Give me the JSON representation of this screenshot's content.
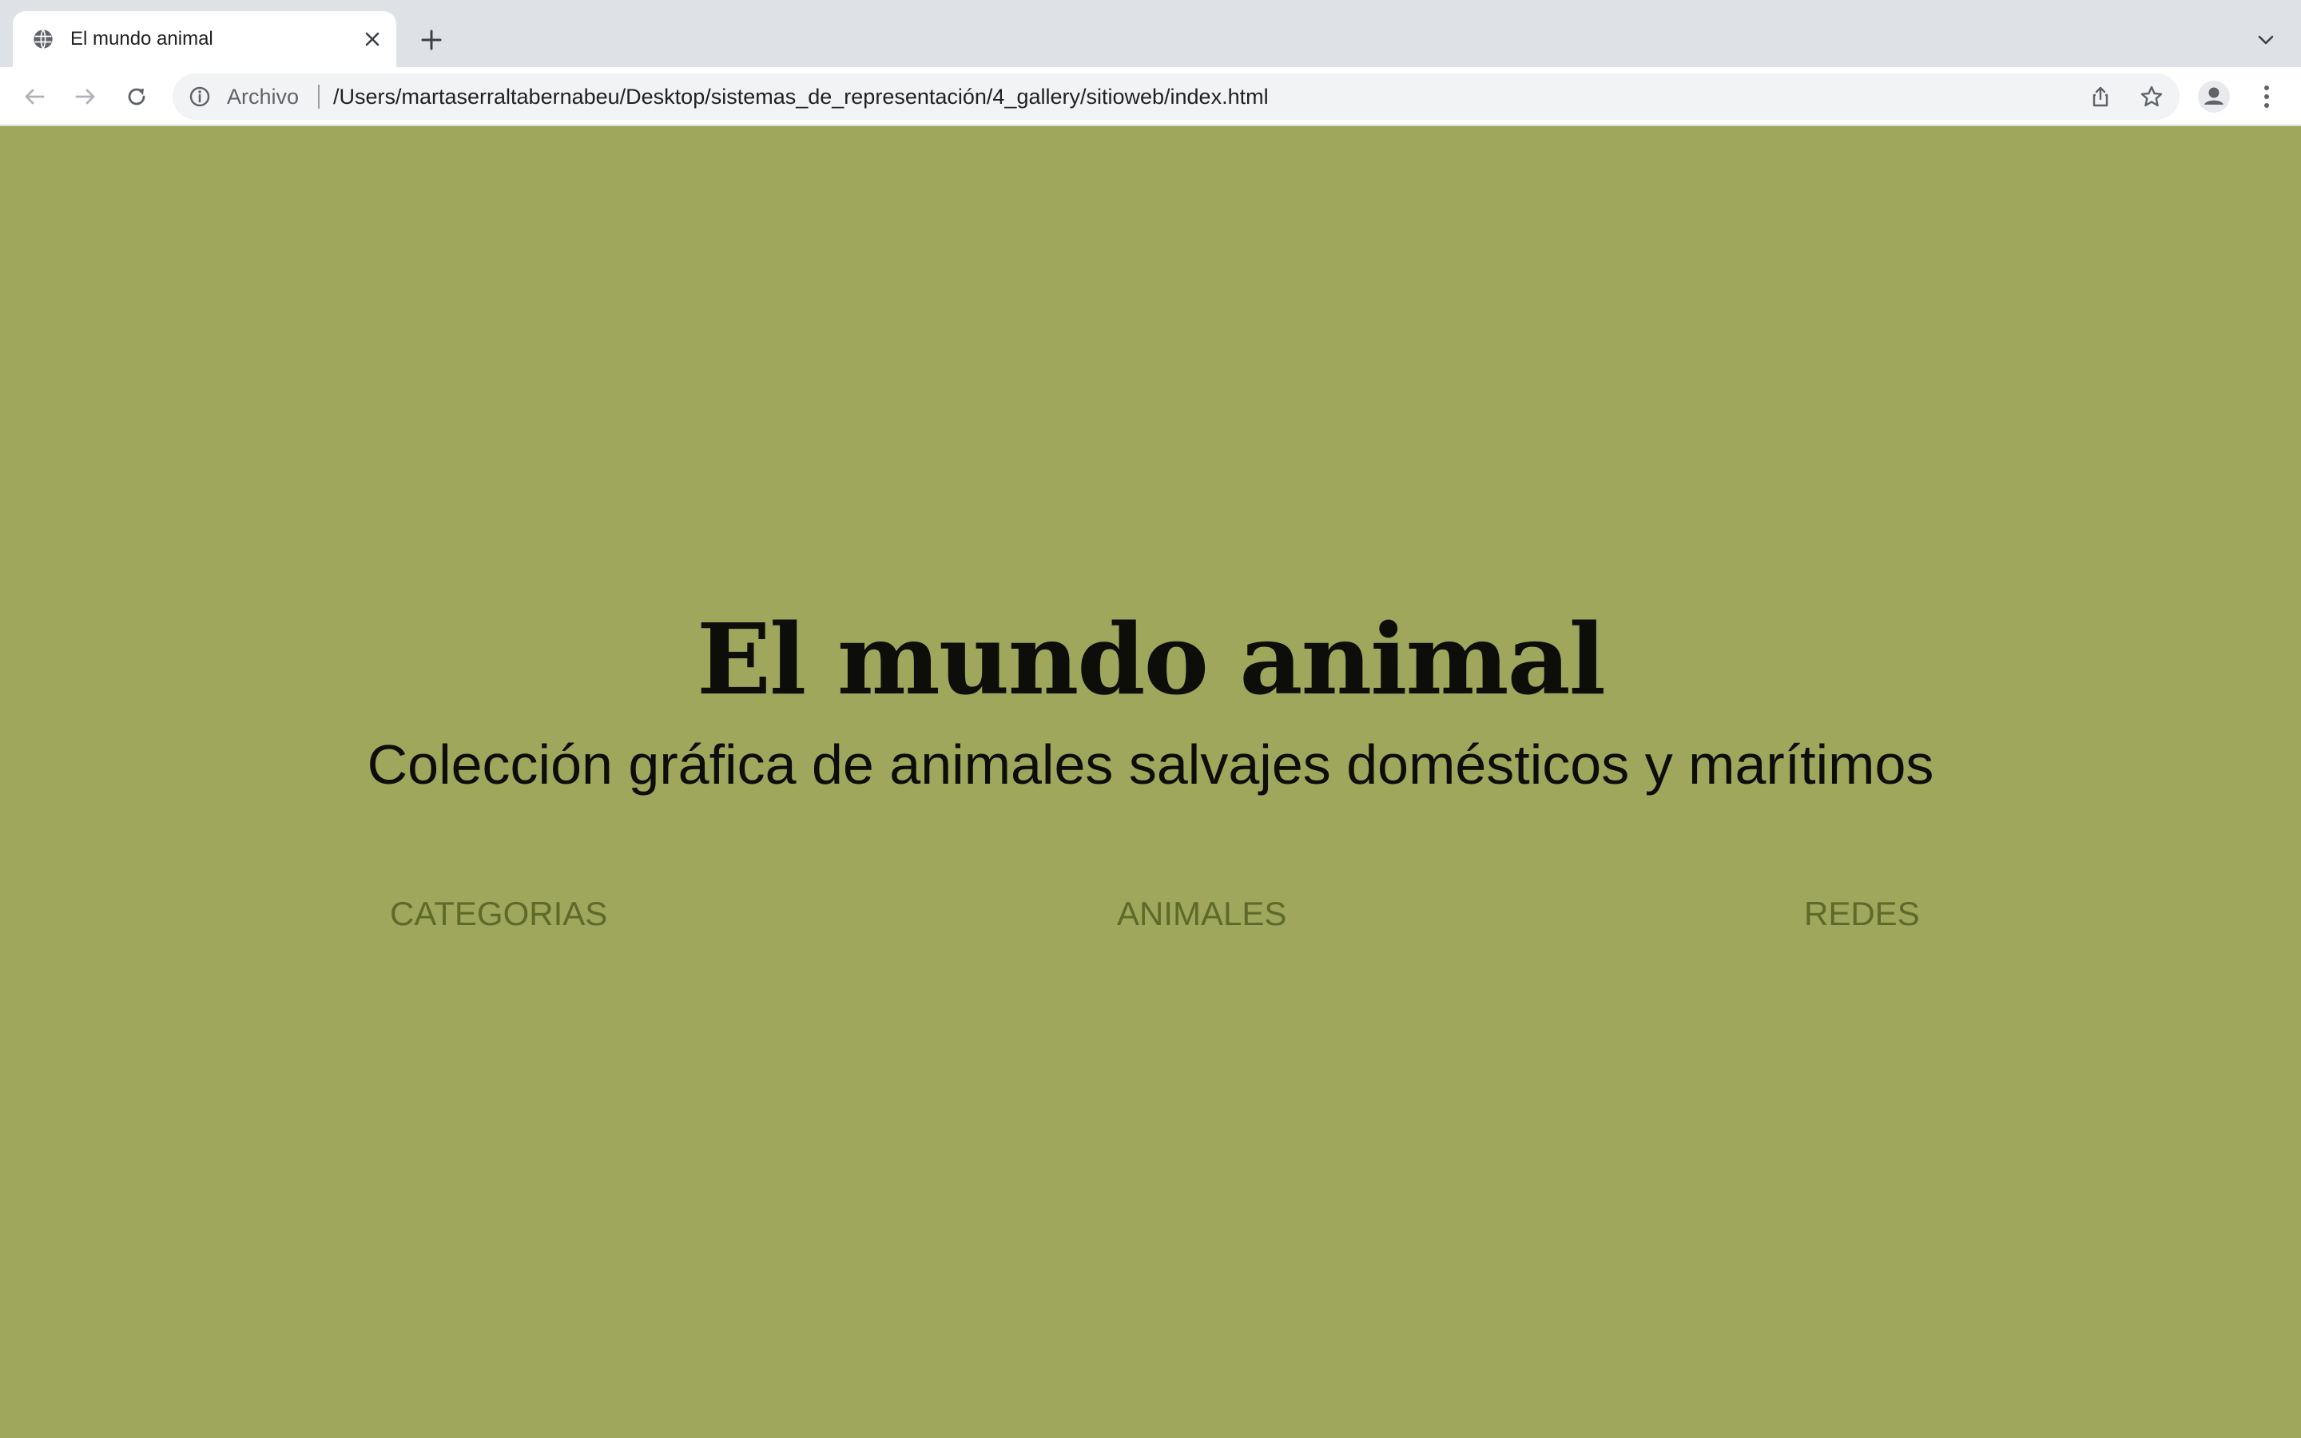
{
  "browser": {
    "tab": {
      "title": "El mundo animal",
      "favicon": "globe-icon"
    },
    "address_bar": {
      "scheme_label": "Archivo",
      "url": "/Users/martaserraltabernabeu/Desktop/sistemas_de_representación/4_gallery/sitioweb/index.html"
    },
    "icons": {
      "back": "arrow-left-icon",
      "forward": "arrow-right-icon",
      "reload": "reload-icon",
      "share": "share-icon",
      "bookmark": "star-icon",
      "profile": "person-icon",
      "menu": "kebab-menu-icon",
      "new_tab": "plus-icon",
      "tab_search": "chevron-down-icon"
    }
  },
  "page": {
    "title": "El mundo animal",
    "subtitle": "Colección gráfica de animales salvajes domésticos y marítimos",
    "nav": [
      {
        "label": "CATEGORIAS"
      },
      {
        "label": "ANIMALES"
      },
      {
        "label": "REDES"
      }
    ]
  },
  "colors": {
    "background": "#9ea75c",
    "heading_text": "#0d0d0a",
    "nav_text": "#5e6a2a",
    "tabstrip": "#dee1e6",
    "toolbar": "#ffffff"
  }
}
